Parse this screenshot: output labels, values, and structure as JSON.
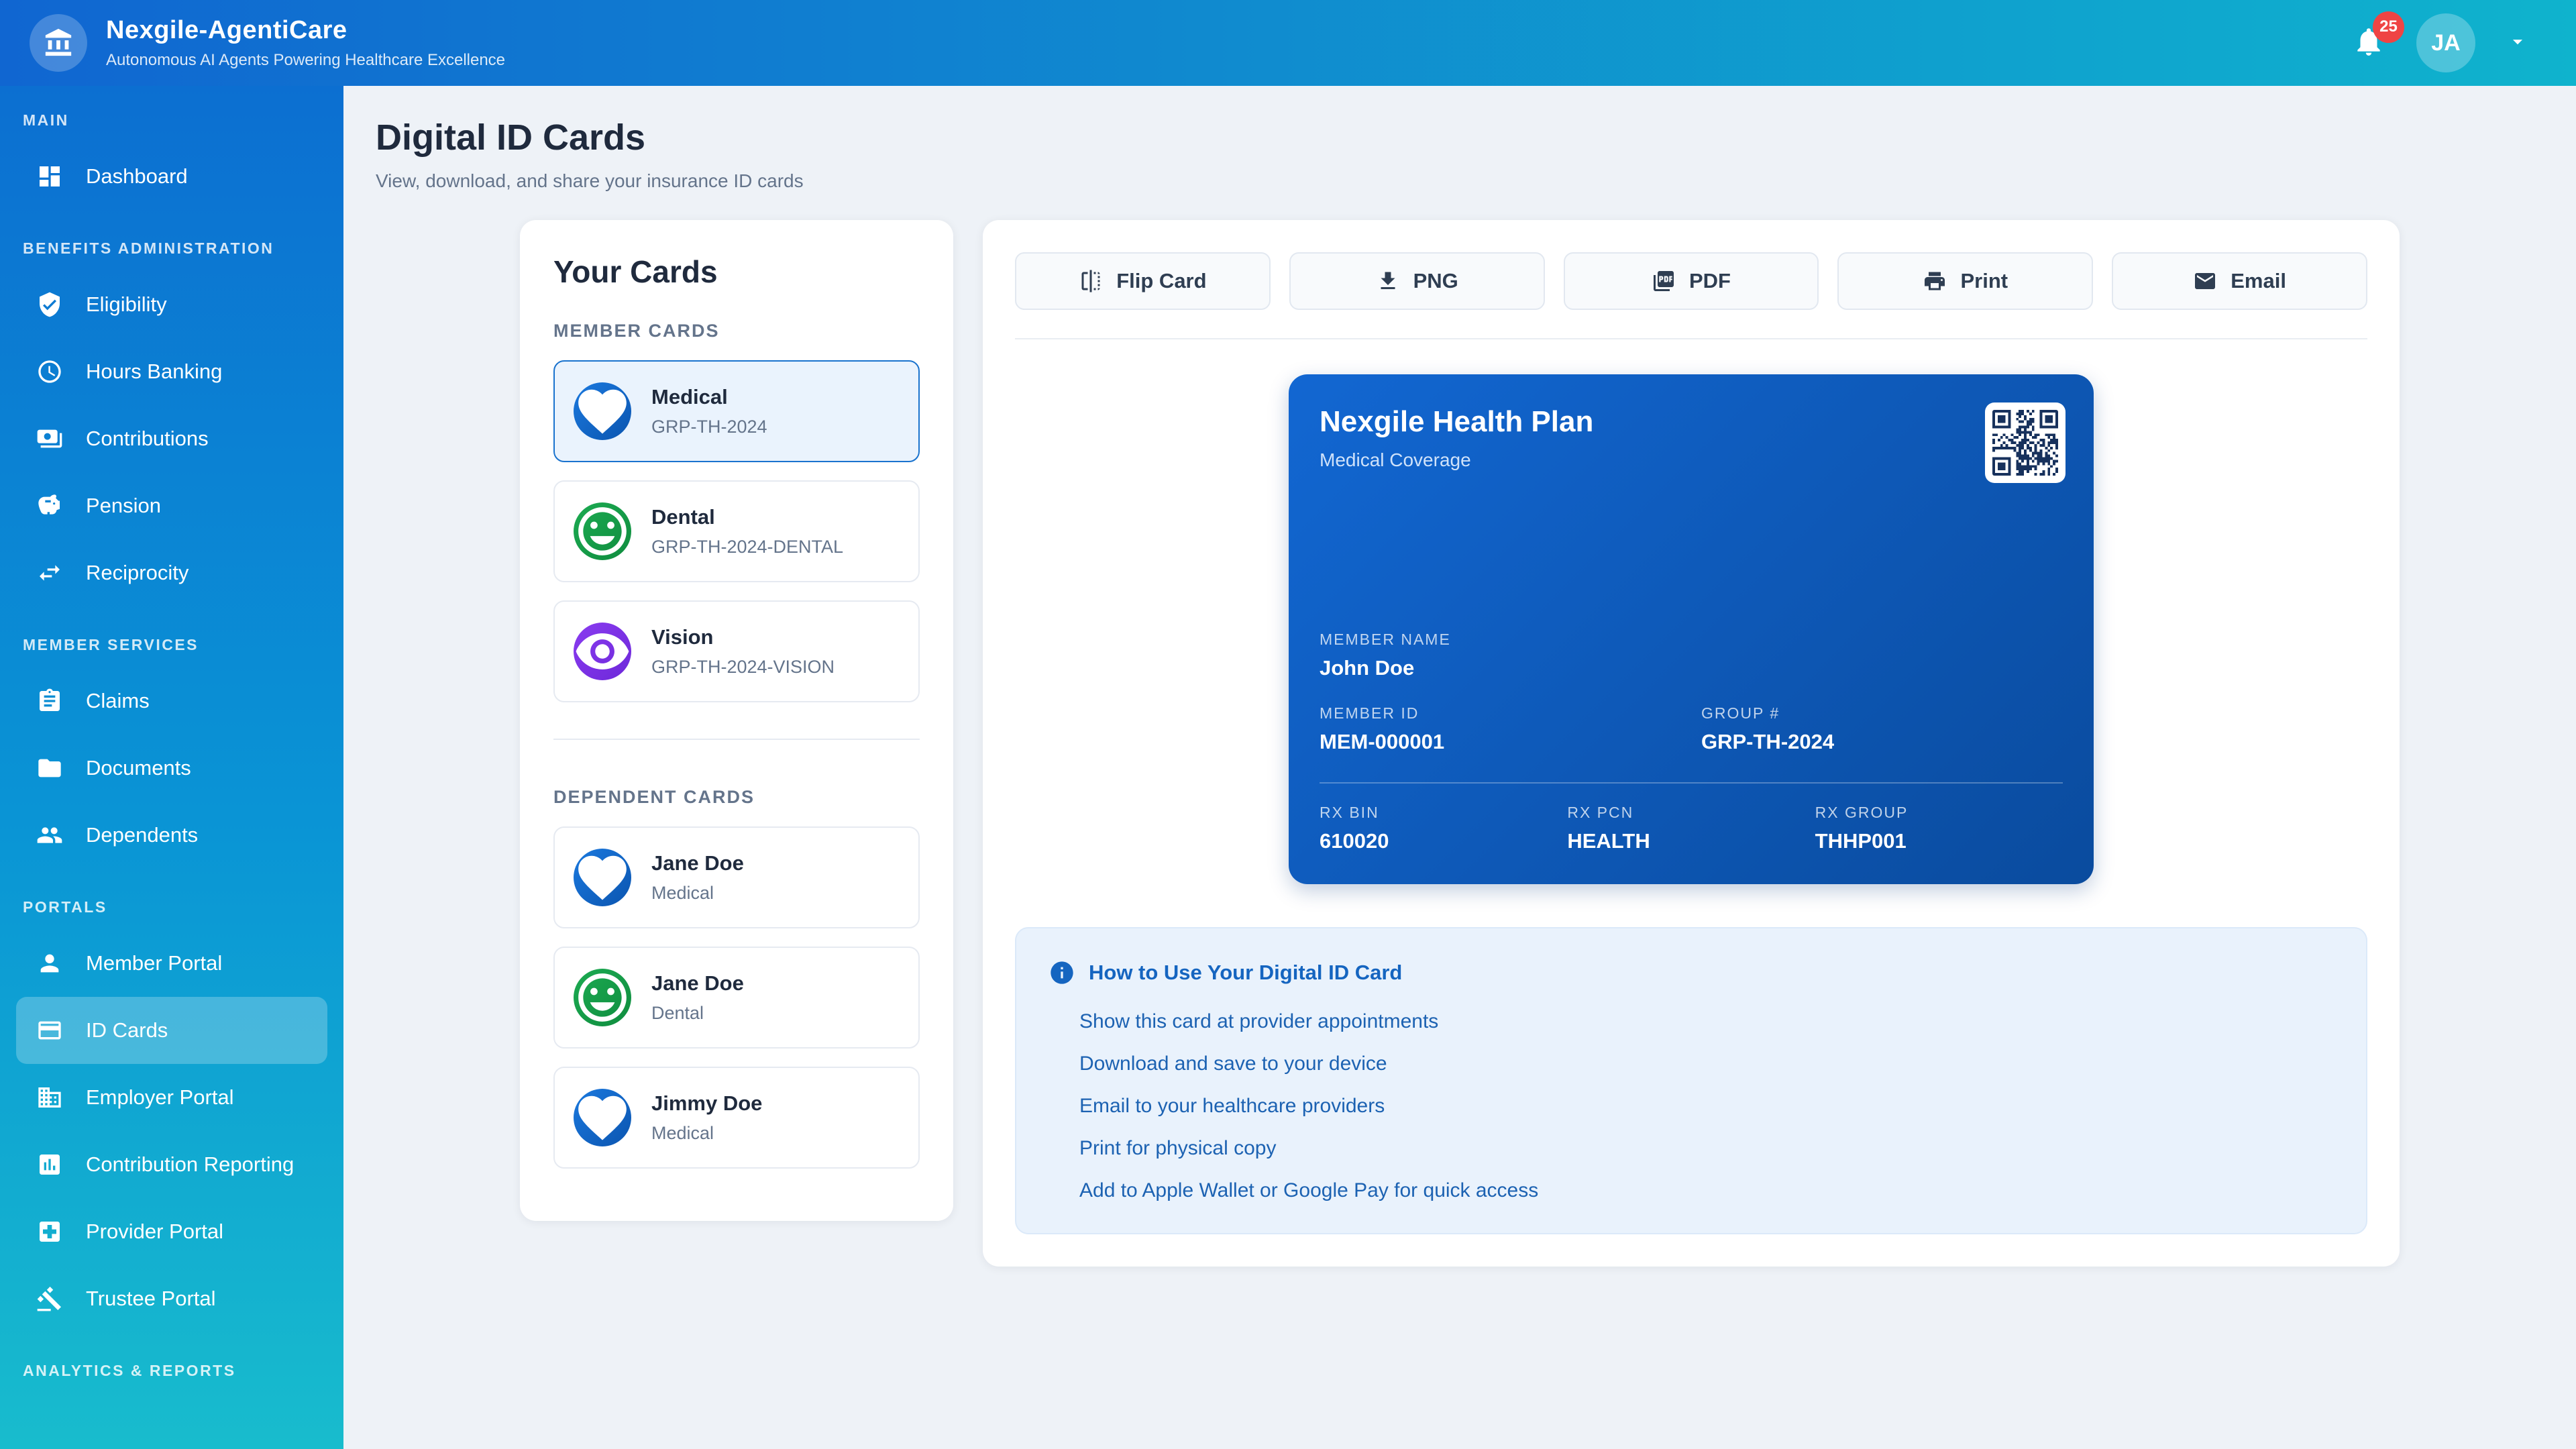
{
  "header": {
    "app_title": "Nexgile-AgentiCare",
    "app_subtitle": "Autonomous AI Agents Powering Healthcare Excellence",
    "logo_icon": "bank-icon",
    "notification_count": "25",
    "avatar_initials": "JA"
  },
  "sidebar": {
    "sections": [
      {
        "label": "MAIN",
        "items": [
          {
            "label": "Dashboard",
            "icon": "dashboard-icon",
            "active": false
          }
        ]
      },
      {
        "label": "BENEFITS ADMINISTRATION",
        "items": [
          {
            "label": "Eligibility",
            "icon": "shield-check-icon",
            "active": false
          },
          {
            "label": "Hours Banking",
            "icon": "clock-icon",
            "active": false
          },
          {
            "label": "Contributions",
            "icon": "payments-icon",
            "active": false
          },
          {
            "label": "Pension",
            "icon": "piggy-bank-icon",
            "active": false
          },
          {
            "label": "Reciprocity",
            "icon": "swap-arrows-icon",
            "active": false
          }
        ]
      },
      {
        "label": "MEMBER SERVICES",
        "items": [
          {
            "label": "Claims",
            "icon": "clipboard-icon",
            "active": false
          },
          {
            "label": "Documents",
            "icon": "folder-icon",
            "active": false
          },
          {
            "label": "Dependents",
            "icon": "family-icon",
            "active": false
          }
        ]
      },
      {
        "label": "PORTALS",
        "items": [
          {
            "label": "Member Portal",
            "icon": "person-icon",
            "active": false
          },
          {
            "label": "ID Cards",
            "icon": "id-card-icon",
            "active": true
          },
          {
            "label": "Employer Portal",
            "icon": "building-icon",
            "active": false
          },
          {
            "label": "Contribution Reporting",
            "icon": "bar-chart-icon",
            "active": false
          },
          {
            "label": "Provider Portal",
            "icon": "medical-cross-icon",
            "active": false
          },
          {
            "label": "Trustee Portal",
            "icon": "gavel-icon",
            "active": false
          }
        ]
      },
      {
        "label": "ANALYTICS & REPORTS",
        "items": []
      }
    ]
  },
  "page": {
    "title": "Digital ID Cards",
    "subtitle": "View, download, and share your insurance ID cards"
  },
  "your_cards": {
    "title": "Your Cards",
    "member_section_label": "MEMBER CARDS",
    "dependent_section_label": "DEPENDENT CARDS",
    "member_cards": [
      {
        "title": "Medical",
        "subtitle": "GRP-TH-2024",
        "icon": "heart-icon",
        "color": "blue",
        "selected": true
      },
      {
        "title": "Dental",
        "subtitle": "GRP-TH-2024-DENTAL",
        "icon": "smiley-icon",
        "color": "green",
        "selected": false
      },
      {
        "title": "Vision",
        "subtitle": "GRP-TH-2024-VISION",
        "icon": "eye-icon",
        "color": "purple",
        "selected": false
      }
    ],
    "dependent_cards": [
      {
        "title": "Jane Doe",
        "subtitle": "Medical",
        "icon": "heart-icon",
        "color": "blue",
        "selected": false
      },
      {
        "title": "Jane Doe",
        "subtitle": "Dental",
        "icon": "smiley-icon",
        "color": "green",
        "selected": false
      },
      {
        "title": "Jimmy Doe",
        "subtitle": "Medical",
        "icon": "heart-icon",
        "color": "blue",
        "selected": false
      }
    ]
  },
  "actions": [
    {
      "label": "Flip Card",
      "icon": "flip-icon"
    },
    {
      "label": "PNG",
      "icon": "download-icon"
    },
    {
      "label": "PDF",
      "icon": "pdf-icon"
    },
    {
      "label": "Print",
      "icon": "printer-icon"
    },
    {
      "label": "Email",
      "icon": "email-icon"
    }
  ],
  "id_card": {
    "plan_name": "Nexgile Health Plan",
    "coverage": "Medical Coverage",
    "member_name_label": "MEMBER NAME",
    "member_name": "John Doe",
    "member_id_label": "MEMBER ID",
    "member_id": "MEM-000001",
    "group_label": "GROUP #",
    "group_number": "GRP-TH-2024",
    "rx_bin_label": "RX BIN",
    "rx_bin": "610020",
    "rx_pcn_label": "RX PCN",
    "rx_pcn": "HEALTH",
    "rx_group_label": "RX GROUP",
    "rx_group": "THHP001"
  },
  "info_box": {
    "icon": "info-icon",
    "title": "How to Use Your Digital ID Card",
    "items": [
      "Show this card at provider appointments",
      "Download and save to your device",
      "Email to your healthcare providers",
      "Print for physical copy",
      "Add to Apple Wallet or Google Pay for quick access"
    ]
  },
  "colors": {
    "header_gradient": [
      "#1066d1",
      "#0fb3cd"
    ],
    "sidebar_gradient": [
      "#0c6fd1",
      "#18bccd"
    ],
    "id_card_gradient": [
      "#1267d2",
      "#0a4b9e"
    ],
    "accent_blue": "#1565c0",
    "badge_red": "#ef4444",
    "medical_blue": "#1565c0",
    "dental_green": "#16a34a",
    "vision_purple": "#7c3aed",
    "info_box_bg": "#e9f2fc",
    "selected_card_border": "#1a73ce",
    "page_bg": "#eef2f7"
  }
}
